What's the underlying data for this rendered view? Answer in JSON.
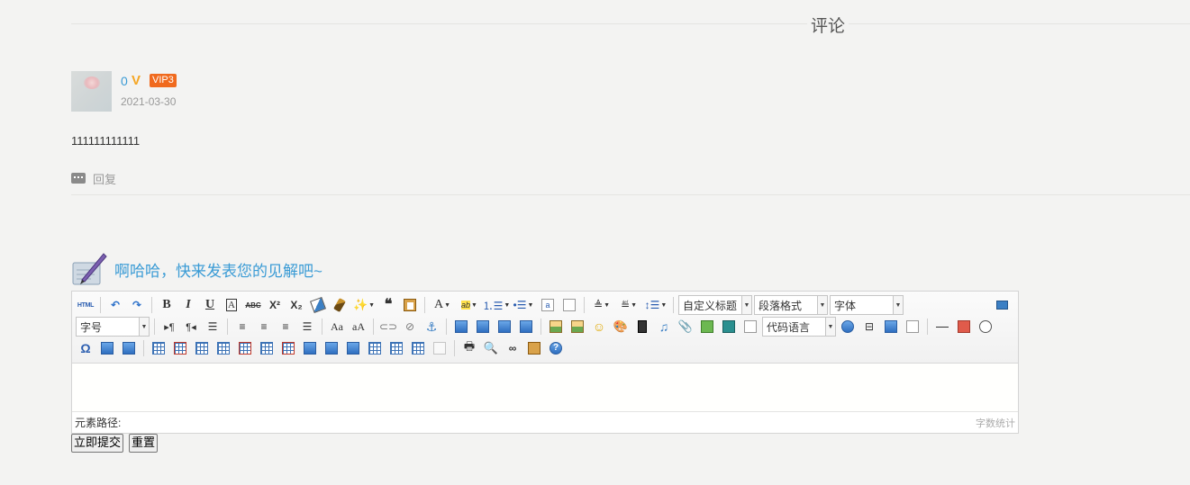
{
  "comments_section": {
    "title": "评论"
  },
  "comment": {
    "username": "0",
    "vip_badge": "VIP3",
    "date": "2021-03-30",
    "content": "111111111111",
    "reply_label": "回复"
  },
  "editor_prompt": "啊哈哈，快来发表您的见解吧~",
  "toolbar": {
    "row1": [
      {
        "name": "source-code-button",
        "icon": "html-icon",
        "text": "HTML"
      },
      {
        "name": "undo-button",
        "icon": "undo-icon"
      },
      {
        "name": "redo-button",
        "icon": "redo-icon"
      },
      {
        "name": "bold-button",
        "icon": "bold-icon",
        "text": "B"
      },
      {
        "name": "italic-button",
        "icon": "italic-icon",
        "text": "I"
      },
      {
        "name": "underline-button",
        "icon": "underline-icon",
        "text": "U"
      },
      {
        "name": "font-border-button",
        "icon": "font-border-icon",
        "text": "A"
      },
      {
        "name": "strikethrough-button",
        "icon": "strikethrough-icon",
        "text": "ABC"
      },
      {
        "name": "superscript-button",
        "icon": "superscript-icon",
        "text": "X²"
      },
      {
        "name": "subscript-button",
        "icon": "subscript-icon",
        "text": "X₂"
      },
      {
        "name": "remove-format-button",
        "icon": "eraser-icon"
      },
      {
        "name": "format-match-button",
        "icon": "brush-icon"
      },
      {
        "name": "auto-typeset-button",
        "icon": "magic-wand-icon"
      },
      {
        "name": "blockquote-button",
        "icon": "quote-icon",
        "text": "66"
      },
      {
        "name": "paste-plain-button",
        "icon": "paste-text-icon"
      },
      {
        "name": "forecolor-button",
        "icon": "font-color-icon",
        "text": "A"
      },
      {
        "name": "backcolor-button",
        "icon": "highlight-icon",
        "text": "ab"
      },
      {
        "name": "ordered-list-button",
        "icon": "ordered-list-icon"
      },
      {
        "name": "unordered-list-button",
        "icon": "unordered-list-icon"
      },
      {
        "name": "select-all-button",
        "icon": "select-all-icon"
      },
      {
        "name": "clear-doc-button",
        "icon": "clear-doc-icon"
      },
      {
        "name": "row-spacing-top-button",
        "icon": "row-spacing-top-icon"
      },
      {
        "name": "row-spacing-bottom-button",
        "icon": "row-spacing-bottom-icon"
      },
      {
        "name": "line-height-button",
        "icon": "line-height-icon"
      }
    ],
    "custom_style_select": "自定义标题",
    "paragraph_select": "段落格式",
    "font_family_select": "字体",
    "font_size_select": "字号",
    "code_language_select": "代码语言"
  },
  "status_bar": {
    "element_path": "元素路径:",
    "word_count": "字数统计"
  },
  "form": {
    "submit": "立即提交",
    "reset": "重置"
  },
  "colors": {
    "accent": "#3a9bd5",
    "vip": "#f06a1e",
    "v_icon": "#f5a623",
    "background": "#f3f3f2"
  }
}
